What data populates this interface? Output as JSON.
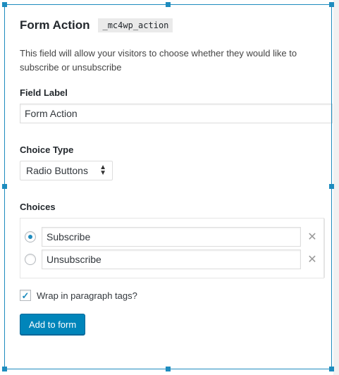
{
  "header": {
    "title": "Form Action",
    "field_name": "_mc4wp_action"
  },
  "description": "This field will allow your visitors to choose whether they would like to subscribe or unsubscribe",
  "field_label": {
    "label": "Field Label",
    "value": "Form Action"
  },
  "choice_type": {
    "label": "Choice Type",
    "selected": "Radio Buttons"
  },
  "choices": {
    "label": "Choices",
    "items": [
      {
        "value": "Subscribe",
        "checked": true
      },
      {
        "value": "Unsubscribe",
        "checked": false
      }
    ]
  },
  "wrap": {
    "label": "Wrap in paragraph tags?",
    "checked": true
  },
  "submit": {
    "label": "Add to form"
  },
  "colors": {
    "accent": "#1e8cbe",
    "button": "#0085ba"
  },
  "icons": {
    "remove": "close-icon",
    "select": "chevron-updown-icon",
    "check": "checkmark-icon"
  }
}
